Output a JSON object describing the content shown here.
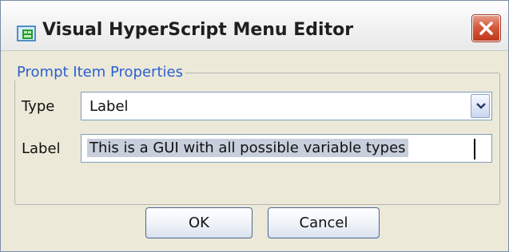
{
  "window": {
    "title": "Visual HyperScript Menu Editor",
    "app_icon": "hyperscript-app-icon",
    "close_icon": "close-icon"
  },
  "group": {
    "legend": "Prompt Item Properties"
  },
  "fields": {
    "type_label": "Type",
    "type_value": "Label",
    "label_label": "Label",
    "label_value": "This is a GUI with all possible variable types"
  },
  "buttons": {
    "ok": "OK",
    "cancel": "Cancel"
  },
  "colors": {
    "legend_blue": "#2b5fd1",
    "close_red": "#d55a3e",
    "dialog_bg": "#ece9d8",
    "selection": "#c7cfdc"
  }
}
